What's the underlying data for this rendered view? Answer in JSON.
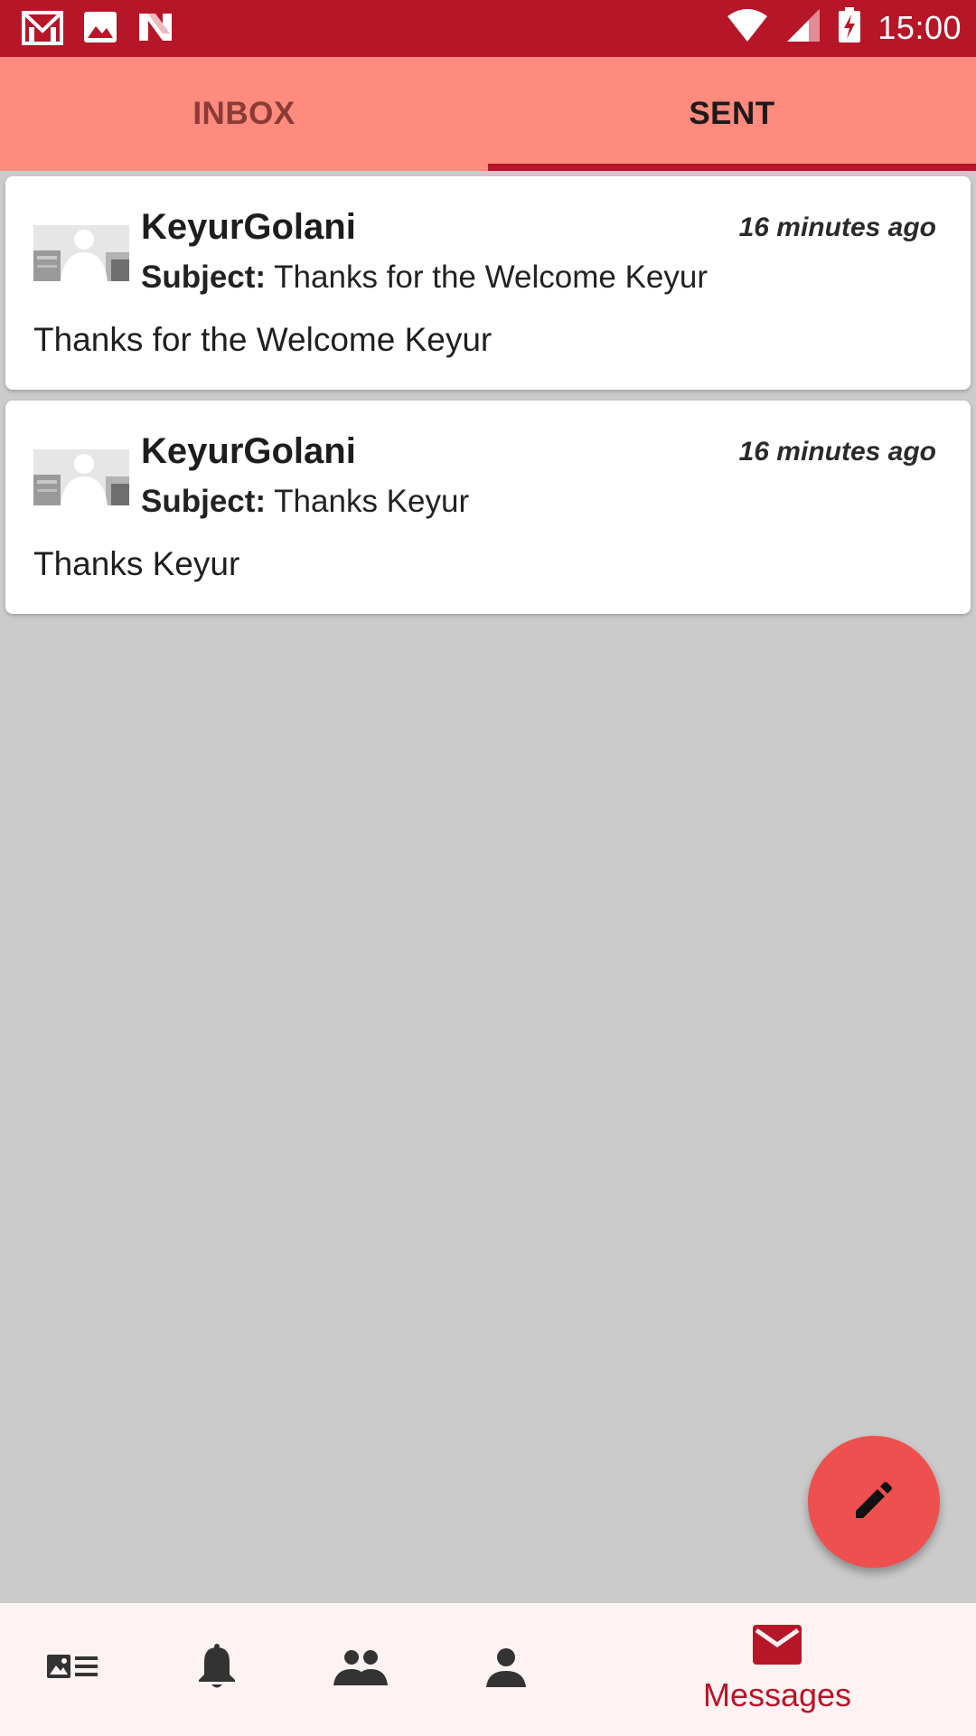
{
  "status_bar": {
    "time": "15:00",
    "icons": [
      "gmail-icon",
      "image-icon",
      "n-icon",
      "wifi-icon",
      "cell-signal-icon",
      "battery-charging-icon"
    ]
  },
  "tabs": [
    {
      "label": "INBOX",
      "active": false
    },
    {
      "label": "SENT",
      "active": true
    }
  ],
  "messages": [
    {
      "sender": "KeyurGolani",
      "time": "16 minutes ago",
      "subject_label": "Subject:",
      "subject": "Thanks for the Welcome Keyur",
      "body": "Thanks for the Welcome Keyur"
    },
    {
      "sender": "KeyurGolani",
      "time": "16 minutes ago",
      "subject_label": "Subject:",
      "subject": "Thanks Keyur",
      "body": "Thanks Keyur"
    }
  ],
  "fab": {
    "icon": "pencil-icon"
  },
  "bottom_nav": {
    "items": [
      {
        "icon": "news-feed-icon"
      },
      {
        "icon": "bell-icon"
      },
      {
        "icon": "group-icon"
      },
      {
        "icon": "person-icon"
      },
      {
        "icon": "mail-icon",
        "label": "Messages",
        "active": true
      }
    ]
  },
  "colors": {
    "status_bar": "#b71528",
    "tab_bar": "#ff8a7e",
    "accent": "#b71528",
    "fab": "#ee4f4f",
    "background": "#cbcbcb"
  }
}
